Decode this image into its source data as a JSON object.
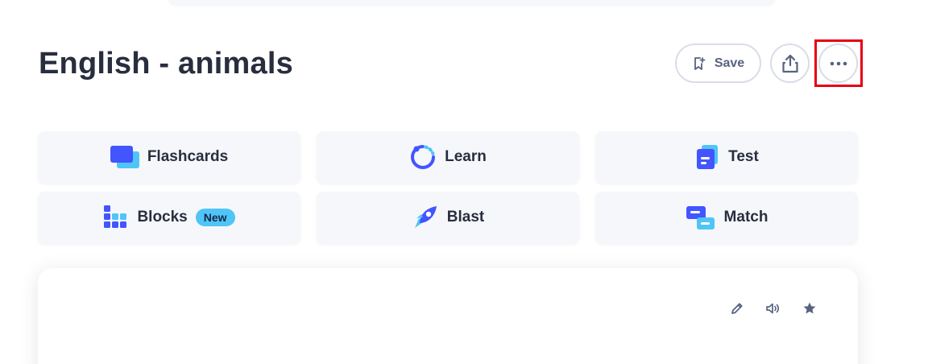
{
  "header": {
    "title": "English - animals",
    "save_label": "Save"
  },
  "study_modes": [
    {
      "label": "Flashcards",
      "icon": "flashcards-icon"
    },
    {
      "label": "Learn",
      "icon": "learn-icon"
    },
    {
      "label": "Test",
      "icon": "test-icon"
    },
    {
      "label": "Blocks",
      "icon": "blocks-icon",
      "badge": "New"
    },
    {
      "label": "Blast",
      "icon": "rocket-icon"
    },
    {
      "label": "Match",
      "icon": "match-icon"
    }
  ],
  "card_actions": [
    "edit-icon",
    "audio-icon",
    "star-icon"
  ],
  "colors": {
    "primary": "#4255ff",
    "accent": "#4fc5f7",
    "highlight": "#e60012",
    "text": "#282e3e",
    "muted": "#586380"
  }
}
